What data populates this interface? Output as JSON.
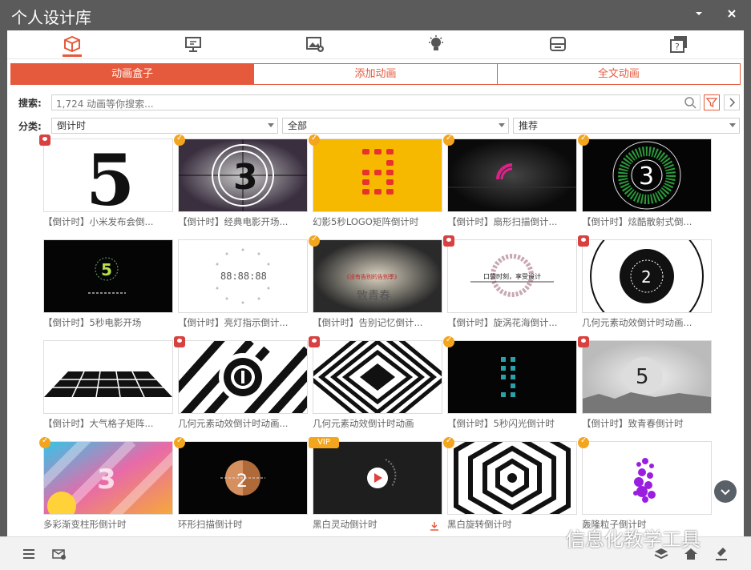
{
  "window": {
    "title": "个人设计库"
  },
  "iconbar": [
    {
      "name": "animation-box-icon"
    },
    {
      "name": "presentation-icon"
    },
    {
      "name": "image-add-icon"
    },
    {
      "name": "lightbulb-icon"
    },
    {
      "name": "storage-icon"
    },
    {
      "name": "help-icon"
    }
  ],
  "tabs": [
    "动画盒子",
    "添加动画",
    "全文动画"
  ],
  "search": {
    "label": "搜索:",
    "placeholder": "1,724 动画等你搜索..."
  },
  "category": {
    "label": "分类:",
    "select1": "倒计时",
    "select2": "全部",
    "select3": "推荐"
  },
  "cards": [
    {
      "caption": "【倒计时】小米发布会倒...",
      "badge": "user"
    },
    {
      "caption": "【倒计时】经典电影开场...",
      "badge": "check"
    },
    {
      "caption": "幻影5秒LOGO矩阵倒计时",
      "badge": "check"
    },
    {
      "caption": "【倒计时】扇形扫描倒计...",
      "badge": "check"
    },
    {
      "caption": "【倒计时】炫酷散射式倒...",
      "badge": "check"
    },
    {
      "caption": "【倒计时】5秒电影开场",
      "badge": ""
    },
    {
      "caption": "【倒计时】亮灯指示倒计...",
      "badge": ""
    },
    {
      "caption": "【倒计时】告别记忆倒计...",
      "badge": "check"
    },
    {
      "caption": "【倒计时】旋涡花海倒计...",
      "badge": "user"
    },
    {
      "caption": "几何元素动效倒计时动画...",
      "badge": "user"
    },
    {
      "caption": "【倒计时】大气格子矩阵...",
      "badge": ""
    },
    {
      "caption": "几何元素动效倒计时动画...",
      "badge": "user"
    },
    {
      "caption": "几何元素动效倒计时动画",
      "badge": "user"
    },
    {
      "caption": "【倒计时】5秒闪光倒计时",
      "badge": "check"
    },
    {
      "caption": "【倒计时】致青春倒计时",
      "badge": "user"
    },
    {
      "caption": "多彩渐变柱形倒计时",
      "badge": "check"
    },
    {
      "caption": "环形扫描倒计时",
      "badge": "check"
    },
    {
      "caption": "黑白灵动倒计时",
      "badge": "vip"
    },
    {
      "caption": "黑白旋转倒计时",
      "badge": "check"
    },
    {
      "caption": "轰隆粒子倒计时",
      "badge": "check"
    }
  ],
  "thumb_text": {
    "t1": "5",
    "t2": "3",
    "t5": "3",
    "t6": "5",
    "t7": "88:88:88",
    "t8a": "《没有告别的告别季》",
    "t8b": "致青春",
    "t9": "口袋时刻，享受设计",
    "t10": "2",
    "t15": "5",
    "t16": "3",
    "t17": "2"
  },
  "vip_label": "VIP",
  "watermark": "信息化教学工具"
}
